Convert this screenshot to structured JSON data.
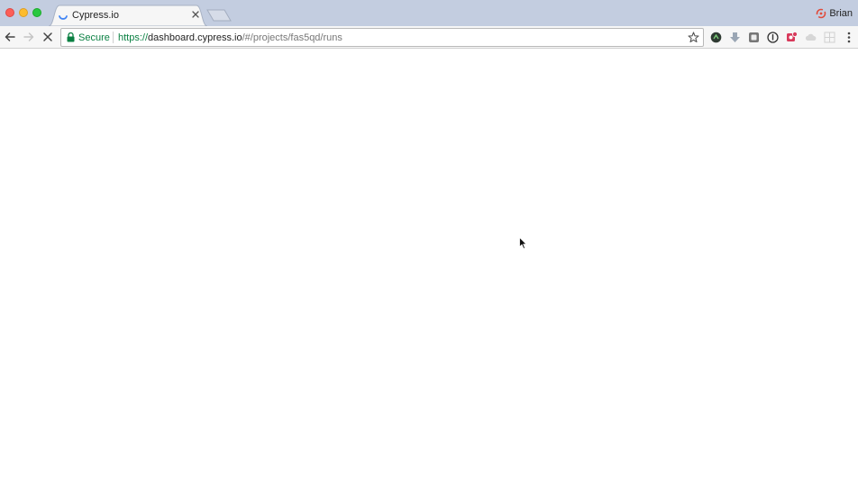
{
  "browser": {
    "tab": {
      "title": "Cypress.io",
      "favicon": "loading-spinner-icon"
    },
    "profile": {
      "name": "Brian",
      "icon": "cypress-profile-icon"
    },
    "omnibox": {
      "security_label": "Secure",
      "url_scheme": "https://",
      "url_host": "dashboard.cypress.io",
      "url_path": "/#/projects/fas5qd/runs"
    },
    "extensions": [
      "circle-dark-extension-icon",
      "download-arrow-extension-icon",
      "square-extension-icon",
      "info-circle-extension-icon",
      "red-badge-extension-icon",
      "cloud-extension-icon",
      "grid-extension-icon"
    ]
  },
  "colors": {
    "tabstrip": "#c3cde0",
    "secure_green": "#0b8043",
    "spinner_blue": "#4285f4"
  }
}
